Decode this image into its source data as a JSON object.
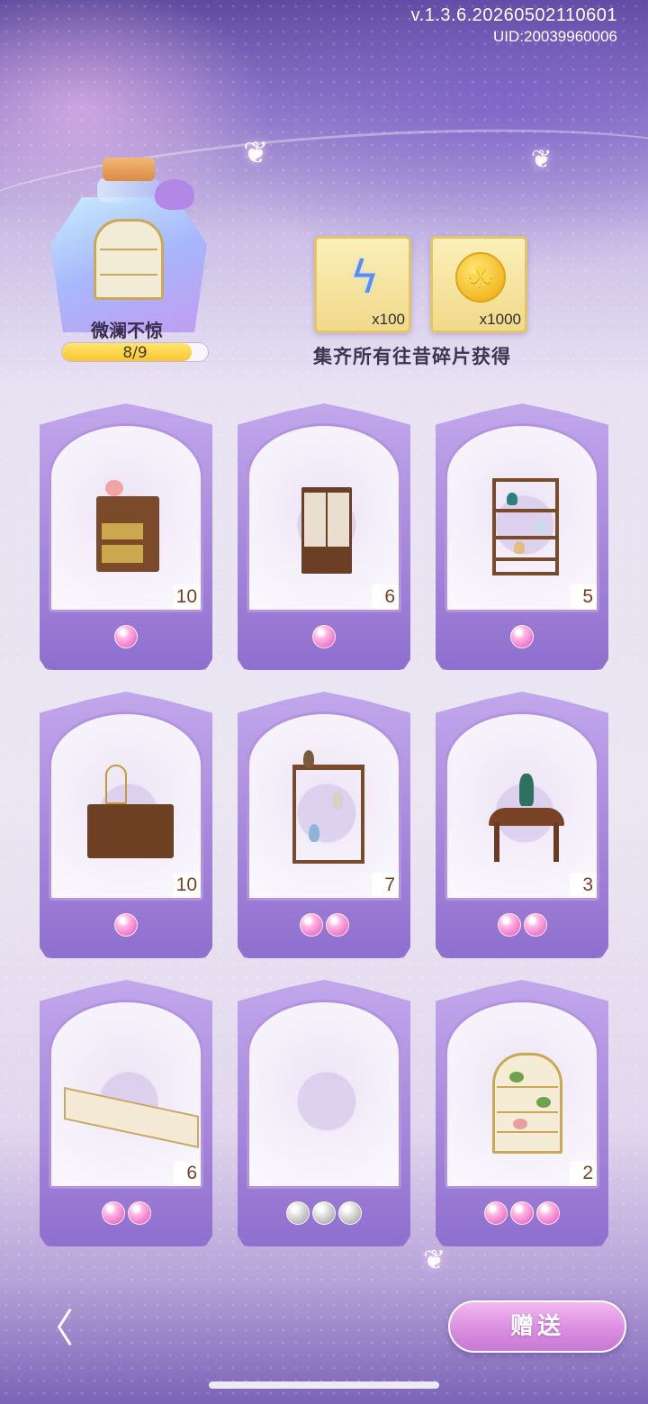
{
  "header": {
    "version": "v.1.3.6.20260502110601",
    "uid": "UID:20039960006"
  },
  "collection": {
    "name": "微澜不惊",
    "progress_text": "8/9",
    "progress_fraction": 0.889
  },
  "rewards": [
    {
      "icon": "energy-bolt-icon",
      "quantity": "x100"
    },
    {
      "icon": "clover-coin-icon",
      "quantity": "x1000"
    }
  ],
  "reward_hint": "集齐所有往昔碎片获得",
  "cards": [
    {
      "item": "wooden-cabinet-with-drawers",
      "count": "10",
      "gems": 1,
      "gem_color": "pink"
    },
    {
      "item": "wardrobe-with-cream-doors",
      "count": "6",
      "gems": 1,
      "gem_color": "pink"
    },
    {
      "item": "asymmetric-display-shelf",
      "count": "5",
      "gems": 1,
      "gem_color": "pink"
    },
    {
      "item": "sideboard-with-birdcage",
      "count": "10",
      "gems": 1,
      "gem_color": "pink"
    },
    {
      "item": "antique-curio-stand",
      "count": "7",
      "gems": 2,
      "gem_color": "pink"
    },
    {
      "item": "half-moon-console-table",
      "count": "3",
      "gems": 2,
      "gem_color": "pink"
    },
    {
      "item": "cream-shop-counter",
      "count": "6",
      "gems": 2,
      "gem_color": "pink"
    },
    {
      "item": "empty-slot",
      "count": "",
      "gems": 3,
      "gem_color": "grey"
    },
    {
      "item": "gold-trim-display-cabinet",
      "count": "2",
      "gems": 3,
      "gem_color": "pink"
    }
  ],
  "buttons": {
    "back_icon": "chevron-left-icon",
    "back_glyph": "〈",
    "gift_label": "赠送"
  },
  "colors": {
    "accent_purple": "#9e7fd6",
    "gem_pink": "#f07bcb",
    "count_text": "#7a3e24",
    "progress_fill": "#f7c532"
  }
}
